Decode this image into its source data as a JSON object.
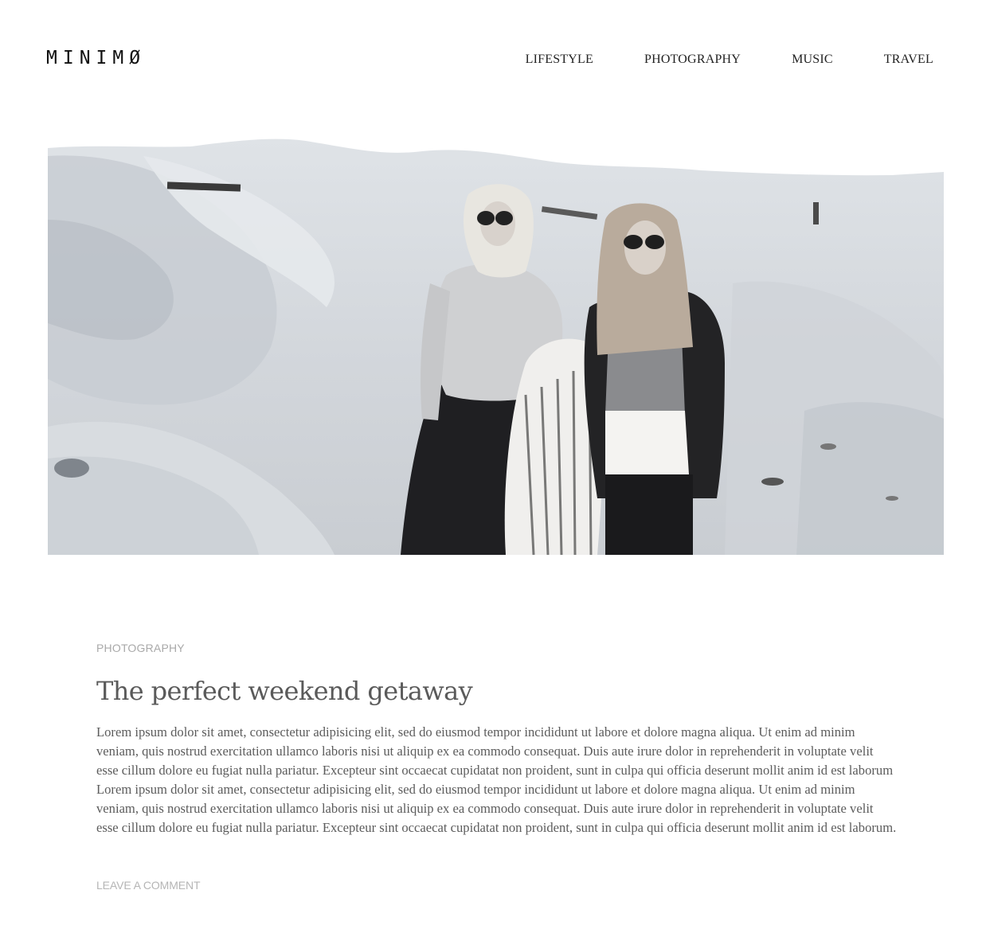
{
  "header": {
    "logo": "MINIMØ",
    "nav": [
      {
        "label": "LIFESTYLE"
      },
      {
        "label": "PHOTOGRAPHY"
      },
      {
        "label": "MUSIC"
      },
      {
        "label": "TRAVEL"
      }
    ]
  },
  "hero": {
    "icon": "featured-photo"
  },
  "post": {
    "category": "PHOTOGRAPHY",
    "title": "The perfect weekend getaway",
    "body": "Lorem ipsum dolor sit amet, consectetur adipisicing elit, sed do eiusmod tempor incididunt ut labore et dolore magna aliqua. Ut enim ad minim veniam, quis nostrud exercitation ullamco laboris nisi ut aliquip ex ea commodo consequat. Duis aute irure dolor in reprehenderit in voluptate velit esse cillum dolore eu fugiat nulla pariatur. Excepteur sint occaecat cupidatat non proident, sunt in culpa qui officia deserunt mollit anim id est laborum Lorem ipsum dolor sit amet, consectetur adipisicing elit, sed do eiusmod tempor incididunt ut labore et dolore magna aliqua. Ut enim ad minim veniam, quis nostrud exercitation ullamco laboris nisi ut aliquip ex ea commodo consequat. Duis aute irure dolor in reprehenderit in voluptate velit esse cillum dolore eu fugiat nulla pariatur. Excepteur sint occaecat cupidatat non proident, sunt in culpa qui officia deserunt mollit anim id est laborum.",
    "comment_link": "LEAVE A COMMENT"
  }
}
